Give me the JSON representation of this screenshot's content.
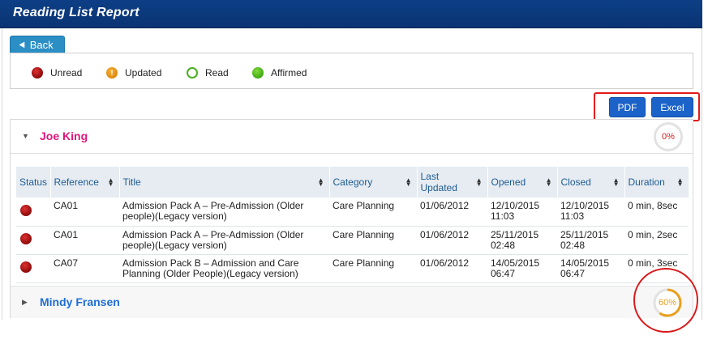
{
  "header": {
    "title": "Reading List Report"
  },
  "nav": {
    "back_label": "Back"
  },
  "legend": [
    {
      "label": "Unread",
      "icon": "unread-dot-icon",
      "color": "#9a0f0f"
    },
    {
      "label": "Updated",
      "icon": "updated-exclamation-icon",
      "color": "#dc8a0c",
      "glyph": "!"
    },
    {
      "label": "Read",
      "icon": "read-ring-icon",
      "color": "#49b01e"
    },
    {
      "label": "Affirmed",
      "icon": "affirmed-dot-icon",
      "color": "#3fa914"
    }
  ],
  "export": {
    "pdf_label": "PDF",
    "excel_label": "Excel"
  },
  "people": [
    {
      "name": "Joe King",
      "percent": "0%",
      "expanded": true,
      "name_color": "#e0177b",
      "percent_color": "#d81b1b",
      "columns": [
        "Status",
        "Reference",
        "Title",
        "Category",
        "Last Updated",
        "Opened",
        "Closed",
        "Duration"
      ],
      "rows": [
        {
          "status": "Unread",
          "reference": "CA01",
          "title": "Admission Pack A – Pre-Admission (Older people)(Legacy version)",
          "category": "Care Planning",
          "last_updated": "01/06/2012",
          "opened": "12/10/2015 11:03",
          "closed": "12/10/2015 11:03",
          "duration": "0 min, 8sec"
        },
        {
          "status": "Unread",
          "reference": "CA01",
          "title": "Admission Pack A – Pre-Admission (Older people)(Legacy version)",
          "category": "Care Planning",
          "last_updated": "01/06/2012",
          "opened": "25/11/2015 02:48",
          "closed": "25/11/2015 02:48",
          "duration": "0 min, 2sec"
        },
        {
          "status": "Unread",
          "reference": "CA07",
          "title": "Admission Pack B – Admission and Care Planning (Older People)(Legacy version)",
          "category": "Care Planning",
          "last_updated": "01/06/2012",
          "opened": "14/05/2015 06:47",
          "closed": "14/05/2015 06:47",
          "duration": "0 min, 3sec"
        }
      ]
    },
    {
      "name": "Mindy Fransen",
      "percent": "60%",
      "expanded": false,
      "name_color": "#1f6ed4",
      "percent_color": "#e8a020",
      "progress": 0.6
    }
  ]
}
